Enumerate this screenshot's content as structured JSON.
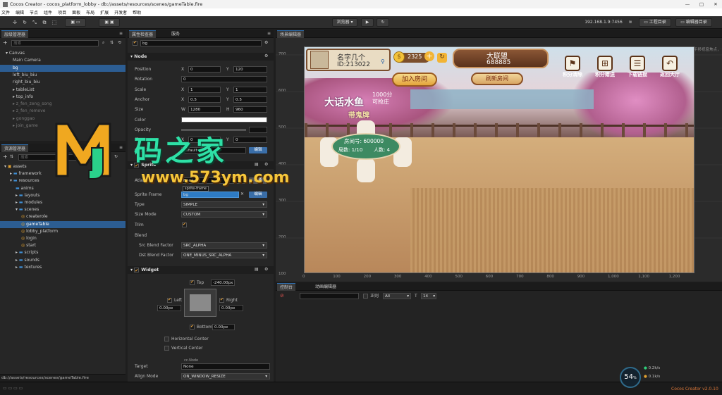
{
  "window": {
    "title": "Cocos Creator  -  cocos_platform_lobby  -  db://assets/resources/scenes/gameTable.fire",
    "min": "—",
    "max": "□",
    "close": "✕"
  },
  "menu": [
    "文件",
    "编辑",
    "节点",
    "组件",
    "项目",
    "面板",
    "布局",
    "扩展",
    "开发者",
    "帮助"
  ],
  "toolbar": {
    "preview_select": "浏览器",
    "ip": "192.168.1.9:7456",
    "wifi": "≋",
    "project_dir": "工程目录",
    "editor_dir": "编辑器目录"
  },
  "hierarchy": {
    "tab": "层级管理器",
    "search": "搜索",
    "items": [
      {
        "label": "Canvas",
        "indent": 0,
        "arrow": "▾",
        "dim": false,
        "sel": false
      },
      {
        "label": "Main Camera",
        "indent": 1,
        "arrow": "",
        "dim": false,
        "sel": false
      },
      {
        "label": "bg",
        "indent": 1,
        "arrow": "",
        "dim": false,
        "sel": true
      },
      {
        "label": "left_biu_biu",
        "indent": 1,
        "arrow": "",
        "dim": false,
        "sel": false
      },
      {
        "label": "right_biu_biu",
        "indent": 1,
        "arrow": "",
        "dim": false,
        "sel": false
      },
      {
        "label": "tableList",
        "indent": 1,
        "arrow": "▸",
        "dim": false,
        "sel": false
      },
      {
        "label": "top_info",
        "indent": 1,
        "arrow": "▸",
        "dim": false,
        "sel": false
      },
      {
        "label": "z_fen_zeng_song",
        "indent": 1,
        "arrow": "▸",
        "dim": true,
        "sel": false
      },
      {
        "label": "z_fen_remove",
        "indent": 1,
        "arrow": "▸",
        "dim": true,
        "sel": false
      },
      {
        "label": "gonggao",
        "indent": 1,
        "arrow": "▸",
        "dim": true,
        "sel": false
      },
      {
        "label": "join_game",
        "indent": 1,
        "arrow": "▸",
        "dim": true,
        "sel": false
      }
    ]
  },
  "assets": {
    "tab": "资源管理器",
    "search": "搜索",
    "items": [
      {
        "label": "assets",
        "indent": 0,
        "arrow": "▾",
        "kind": "db"
      },
      {
        "label": "framework",
        "indent": 1,
        "arrow": "▸",
        "kind": "folder"
      },
      {
        "label": "resources",
        "indent": 1,
        "arrow": "▾",
        "kind": "folder"
      },
      {
        "label": "anims",
        "indent": 2,
        "arrow": "",
        "kind": "folder"
      },
      {
        "label": "layouts",
        "indent": 2,
        "arrow": "▸",
        "kind": "folder"
      },
      {
        "label": "modules",
        "indent": 2,
        "arrow": "▸",
        "kind": "folder"
      },
      {
        "label": "scenes",
        "indent": 2,
        "arrow": "▾",
        "kind": "folder"
      },
      {
        "label": "createrole",
        "indent": 3,
        "arrow": "",
        "kind": "scene"
      },
      {
        "label": "gameTable",
        "indent": 3,
        "arrow": "",
        "kind": "scene",
        "sel": true
      },
      {
        "label": "lobby_platform",
        "indent": 3,
        "arrow": "",
        "kind": "scene"
      },
      {
        "label": "login",
        "indent": 3,
        "arrow": "",
        "kind": "scene"
      },
      {
        "label": "start",
        "indent": 3,
        "arrow": "",
        "kind": "scene"
      },
      {
        "label": "scripts",
        "indent": 2,
        "arrow": "▸",
        "kind": "folder"
      },
      {
        "label": "sounds",
        "indent": 2,
        "arrow": "▸",
        "kind": "folder"
      },
      {
        "label": "textures",
        "indent": 2,
        "arrow": "▸",
        "kind": "folder"
      }
    ],
    "status": "db://assets/resources/scenes/gameTable.fire"
  },
  "inspector": {
    "tab_props": "属性检查器",
    "tab_service": "服务",
    "node_name": "bg",
    "node_section": "Node",
    "position": {
      "label": "Position",
      "x": "0",
      "y": "120"
    },
    "rotation": {
      "label": "Rotation",
      "v": "0"
    },
    "scale": {
      "label": "Scale",
      "x": "1",
      "y": "1"
    },
    "anchor": {
      "label": "Anchor",
      "x": "0.5",
      "y": "0.5"
    },
    "size": {
      "label": "Size",
      "w": "1280",
      "h": "960"
    },
    "color": {
      "label": "Color"
    },
    "opacity": {
      "label": "Opacity"
    },
    "skew": {
      "label": "Skew",
      "x": "0",
      "y": "0"
    },
    "group": {
      "label": "Group",
      "v": "default",
      "btn": "编辑"
    },
    "axis_x": "X",
    "axis_y": "Y",
    "axis_w": "W",
    "axis_h": "H",
    "sprite_section": "Sprite",
    "atlas": {
      "label": "Atlas",
      "v": "None",
      "btn": "选择"
    },
    "sprite_frame": {
      "label": "Sprite Frame",
      "v": "bg",
      "tooltip": "sprite-frame",
      "btn": "编辑"
    },
    "type": {
      "label": "Type",
      "v": "SIMPLE"
    },
    "size_mode": {
      "label": "Size Mode",
      "v": "CUSTOM"
    },
    "trim": {
      "label": "Trim"
    },
    "blend": {
      "label": "Blend"
    },
    "src_blend": {
      "label": "Src Blend Factor",
      "v": "SRC_ALPHA"
    },
    "dst_blend": {
      "label": "Dst Blend Factor",
      "v": "ONE_MINUS_SRC_ALPHA"
    },
    "widget_section": "Widget",
    "widget": {
      "top": "Top",
      "top_v": "-240.00px",
      "left": "Left",
      "left_v": "0.00px",
      "right": "Right",
      "right_v": "0.00px",
      "bottom": "Bottom",
      "bottom_v": "0.00px",
      "hcenter": "Horizontal Center",
      "vcenter": "Vertical Center",
      "target": "Target",
      "target_tag": "cc.Node",
      "target_v": "None",
      "align": "Align Mode",
      "align_v": "ON_WINDOW_RESIZE"
    }
  },
  "scene": {
    "tab": "场景编辑器",
    "hint": "使用鼠标右键平移视窗焦点，使用滚轮缩放视图",
    "xticks": [
      "0",
      "100",
      "200",
      "300",
      "400",
      "500",
      "600",
      "700",
      "800",
      "900",
      "1,000",
      "1,100",
      "1,200"
    ],
    "yticks": [
      "700",
      "600",
      "500",
      "400",
      "300",
      "200",
      "100"
    ],
    "game": {
      "player_name": "名字几个",
      "player_id": "ID:213022",
      "coins": "2325",
      "alliance": "大联盟",
      "alliance_id": "688885",
      "join_room": "加入房间",
      "refresh_room": "刷新房间",
      "icon1": "积分清除",
      "icon2": "积分赠送",
      "icon3": "下载链接",
      "icon4": "返回大厅",
      "game_title": "大话水鱼",
      "game_sub1": "1000分",
      "game_sub2": "可抢庄",
      "game_tag": "带鬼牌",
      "room_no": "房间号: 600000",
      "rounds": "局数: 1/10",
      "players": "人数:  4"
    }
  },
  "watermark": {
    "line1": "码之家",
    "line2": "www.573ym.com"
  },
  "console": {
    "tab_console": "控制台",
    "tab_anim": "动画编辑器",
    "regex": "正则",
    "level": "All",
    "font_size": "14"
  },
  "fps": {
    "value": "54",
    "unit": "%",
    "up": "0.2",
    "down": "0.1",
    "rate": "k/s"
  },
  "version": "Cocos Creator v2.0.10"
}
